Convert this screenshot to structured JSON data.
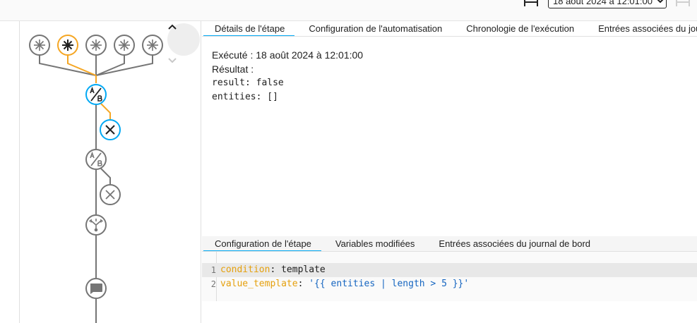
{
  "toolbar": {
    "run_selector": {
      "value": "18 août 2024 à 12:01:00",
      "options": [
        "18 août 2024 à 12:01:00"
      ]
    },
    "icons": [
      "arrow-expand-horizontal-icon",
      "arrow-expand-horizontal-disabled-icon"
    ]
  },
  "graph": {
    "nav": {
      "up_icon": "chevron-up-icon",
      "down_icon": "chevron-down-icon"
    },
    "colors": {
      "active": "#f5a623",
      "selected": "#03a9f4",
      "inactive": "#757575"
    },
    "nodes": [
      {
        "name": "trigger-1",
        "icon": "asterisk-icon",
        "state": "inactive"
      },
      {
        "name": "trigger-2",
        "icon": "asterisk-icon",
        "state": "active"
      },
      {
        "name": "trigger-3",
        "icon": "asterisk-icon",
        "state": "inactive"
      },
      {
        "name": "trigger-4",
        "icon": "asterisk-icon",
        "state": "inactive"
      },
      {
        "name": "trigger-5",
        "icon": "asterisk-icon",
        "state": "inactive"
      },
      {
        "name": "condition-1",
        "icon": "ab-testing-icon",
        "state": "selected"
      },
      {
        "name": "stop-1",
        "icon": "close-icon",
        "state": "selected"
      },
      {
        "name": "condition-2",
        "icon": "ab-testing-icon",
        "state": "inactive"
      },
      {
        "name": "stop-2",
        "icon": "close-icon",
        "state": "inactive"
      },
      {
        "name": "choose",
        "icon": "call-split-icon",
        "state": "inactive"
      },
      {
        "name": "message",
        "icon": "message-icon",
        "state": "inactive"
      }
    ]
  },
  "top_tabs": [
    "Détails de l'étape",
    "Configuration de l'automatisation",
    "Chronologie de l'exécution",
    "Entrées associées du journal de bord"
  ],
  "details": {
    "executed": "Exécuté : 18 août 2024 à 12:01:00",
    "result_label": "Résultat :",
    "result_lines": [
      "result: false",
      "entities: []"
    ]
  },
  "bottom_tabs": [
    "Configuration de l'étape",
    "Variables modifiées",
    "Entrées associées du journal de bord"
  ],
  "code": {
    "lines": [
      {
        "number": "1",
        "key": "condition",
        "sep": ": ",
        "value": "template"
      },
      {
        "number": "2",
        "key": "value_template",
        "sep": ": ",
        "value": "'{{ entities | length > 5 }}'"
      }
    ]
  }
}
